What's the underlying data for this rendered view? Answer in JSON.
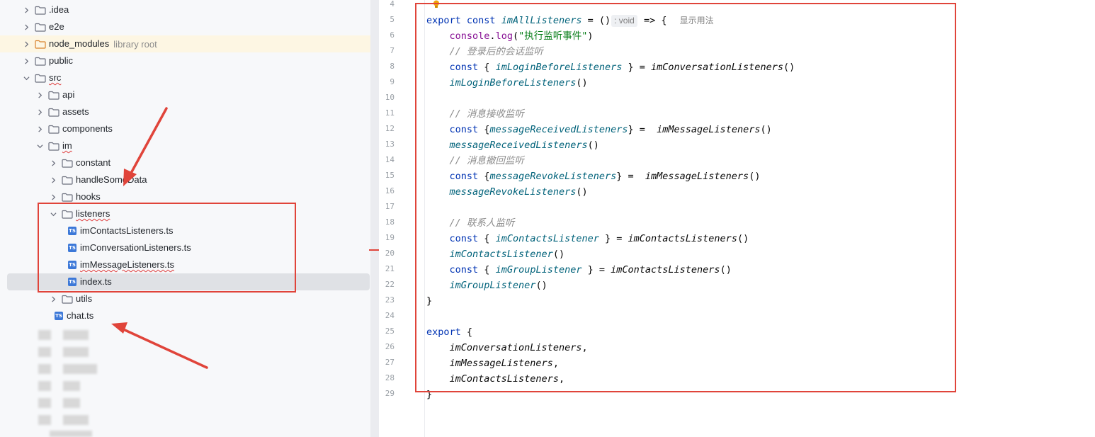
{
  "project_tree": {
    "items": [
      {
        "label": ".idea",
        "kind": "folder",
        "state": "collapsed",
        "depth": 0
      },
      {
        "label": "e2e",
        "kind": "folder",
        "state": "collapsed",
        "depth": 0
      },
      {
        "label": "node_modules",
        "hint": "library root",
        "kind": "folder-excluded",
        "state": "collapsed",
        "depth": 0,
        "highlighted": true
      },
      {
        "label": "public",
        "kind": "folder",
        "state": "collapsed",
        "depth": 0
      },
      {
        "label": "src",
        "kind": "folder",
        "state": "expanded",
        "depth": 0
      },
      {
        "label": "api",
        "kind": "folder",
        "state": "collapsed",
        "depth": 1
      },
      {
        "label": "assets",
        "kind": "folder",
        "state": "collapsed",
        "depth": 1
      },
      {
        "label": "components",
        "kind": "folder",
        "state": "collapsed",
        "depth": 1
      },
      {
        "label": "im",
        "kind": "folder",
        "state": "expanded",
        "depth": 1
      },
      {
        "label": "constant",
        "kind": "folder",
        "state": "collapsed",
        "depth": 2
      },
      {
        "label": "handleSomeData",
        "kind": "folder",
        "state": "collapsed",
        "depth": 2
      },
      {
        "label": "hooks",
        "kind": "folder",
        "state": "collapsed",
        "depth": 2
      },
      {
        "label": "listeners",
        "kind": "folder",
        "state": "expanded",
        "depth": 2
      },
      {
        "label": "imContactsListeners.ts",
        "kind": "ts",
        "depth": 3
      },
      {
        "label": "imConversationListeners.ts",
        "kind": "ts",
        "depth": 3
      },
      {
        "label": "imMessageListeners.ts",
        "kind": "ts",
        "depth": 3
      },
      {
        "label": "index.ts",
        "kind": "ts",
        "depth": 3,
        "selected": true
      },
      {
        "label": "utils",
        "kind": "folder",
        "state": "collapsed",
        "depth": 2
      },
      {
        "label": "chat.ts",
        "kind": "ts",
        "depth": 2
      }
    ]
  },
  "editor": {
    "inlay_type": ": void",
    "usage_hint": "显示用法",
    "lines": [
      {
        "n": "4"
      },
      {
        "n": "5",
        "p": [
          [
            "kw",
            "export "
          ],
          [
            "kw",
            "const "
          ],
          [
            "fn",
            "imAllListeners"
          ],
          [
            "t",
            " = ()"
          ],
          [
            "inlay",
            ": void"
          ],
          [
            "t",
            " => { "
          ],
          [
            "usage",
            "显示用法"
          ]
        ]
      },
      {
        "n": "6",
        "p": [
          [
            "t",
            "    "
          ],
          [
            "vr",
            "console"
          ],
          [
            "t",
            "."
          ],
          [
            "vr",
            "log"
          ],
          [
            "t",
            "("
          ],
          [
            "str",
            "\"执行监听事件\""
          ],
          [
            "t",
            ")"
          ]
        ]
      },
      {
        "n": "7",
        "p": [
          [
            "t",
            "    "
          ],
          [
            "cm",
            "// 登录后的会话监听"
          ]
        ]
      },
      {
        "n": "8",
        "p": [
          [
            "t",
            "    "
          ],
          [
            "kw",
            "const "
          ],
          [
            "t",
            "{ "
          ],
          [
            "fn",
            "imLoginBeforeListeners"
          ],
          [
            "t",
            " } = "
          ],
          [
            "call",
            "imConversationListeners"
          ],
          [
            "t",
            "()"
          ]
        ]
      },
      {
        "n": "9",
        "p": [
          [
            "t",
            "    "
          ],
          [
            "fn",
            "imLoginBeforeListeners"
          ],
          [
            "t",
            "()"
          ]
        ]
      },
      {
        "n": "10"
      },
      {
        "n": "11",
        "p": [
          [
            "t",
            "    "
          ],
          [
            "cm",
            "// 消息接收监听"
          ]
        ]
      },
      {
        "n": "12",
        "p": [
          [
            "t",
            "    "
          ],
          [
            "kw",
            "const "
          ],
          [
            "t",
            "{"
          ],
          [
            "fn",
            "messageReceivedListeners"
          ],
          [
            "t",
            "} =  "
          ],
          [
            "call",
            "imMessageListeners"
          ],
          [
            "t",
            "()"
          ]
        ]
      },
      {
        "n": "13",
        "p": [
          [
            "t",
            "    "
          ],
          [
            "fn",
            "messageReceivedListeners"
          ],
          [
            "t",
            "()"
          ]
        ]
      },
      {
        "n": "14",
        "p": [
          [
            "t",
            "    "
          ],
          [
            "cm",
            "// 消息撤回监听"
          ]
        ]
      },
      {
        "n": "15",
        "p": [
          [
            "t",
            "    "
          ],
          [
            "kw",
            "const "
          ],
          [
            "t",
            "{"
          ],
          [
            "fn",
            "messageRevokeListeners"
          ],
          [
            "t",
            "} =  "
          ],
          [
            "call",
            "imMessageListeners"
          ],
          [
            "t",
            "()"
          ]
        ]
      },
      {
        "n": "16",
        "p": [
          [
            "t",
            "    "
          ],
          [
            "fn",
            "messageRevokeListeners"
          ],
          [
            "t",
            "()"
          ]
        ]
      },
      {
        "n": "17"
      },
      {
        "n": "18",
        "p": [
          [
            "t",
            "    "
          ],
          [
            "cm",
            "// 联系人监听"
          ]
        ]
      },
      {
        "n": "19",
        "p": [
          [
            "t",
            "    "
          ],
          [
            "kw",
            "const "
          ],
          [
            "t",
            "{ "
          ],
          [
            "fn",
            "imContactsListener"
          ],
          [
            "t",
            " } = "
          ],
          [
            "call",
            "imContactsListeners"
          ],
          [
            "t",
            "()"
          ]
        ]
      },
      {
        "n": "20",
        "p": [
          [
            "t",
            "    "
          ],
          [
            "fn",
            "imContactsListener"
          ],
          [
            "t",
            "()"
          ]
        ]
      },
      {
        "n": "21",
        "p": [
          [
            "t",
            "    "
          ],
          [
            "kw",
            "const "
          ],
          [
            "t",
            "{ "
          ],
          [
            "fn",
            "imGroupListener"
          ],
          [
            "t",
            " } = "
          ],
          [
            "call",
            "imContactsListeners"
          ],
          [
            "t",
            "()"
          ]
        ]
      },
      {
        "n": "22",
        "p": [
          [
            "t",
            "    "
          ],
          [
            "fn",
            "imGroupListener"
          ],
          [
            "t",
            "()"
          ]
        ]
      },
      {
        "n": "23",
        "p": [
          [
            "t",
            "}"
          ]
        ]
      },
      {
        "n": "24"
      },
      {
        "n": "25",
        "p": [
          [
            "kw",
            "export "
          ],
          [
            "t",
            "{"
          ]
        ]
      },
      {
        "n": "26",
        "p": [
          [
            "t",
            "    "
          ],
          [
            "call",
            "imConversationListeners"
          ],
          [
            "t",
            ","
          ]
        ]
      },
      {
        "n": "27",
        "p": [
          [
            "t",
            "    "
          ],
          [
            "call",
            "imMessageListeners"
          ],
          [
            "t",
            ","
          ]
        ]
      },
      {
        "n": "28",
        "p": [
          [
            "t",
            "    "
          ],
          [
            "call",
            "imContactsListeners"
          ],
          [
            "t",
            ","
          ]
        ]
      },
      {
        "n": "29",
        "p": [
          [
            "t",
            "}"
          ]
        ]
      }
    ]
  },
  "colors": {
    "annotation_red": "#e0443a",
    "keyword": "#0033b3",
    "function": "#00627a",
    "string": "#067d17",
    "comment": "#8c8c8c",
    "selection": "#dfe1e5",
    "library_highlight": "#fdf6e3"
  }
}
